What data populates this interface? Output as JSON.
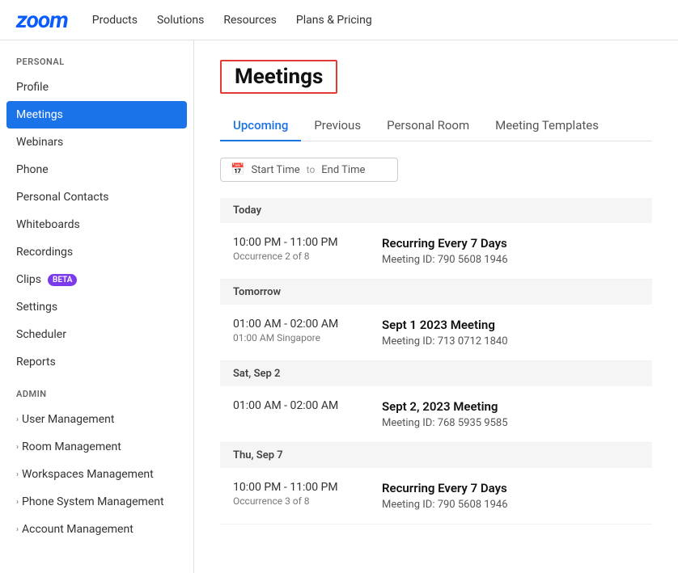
{
  "nav": {
    "logo": "zoom",
    "items": [
      "Products",
      "Solutions",
      "Resources",
      "Plans & Pricing"
    ]
  },
  "sidebar": {
    "personal_label": "PERSONAL",
    "admin_label": "ADMIN",
    "personal_items": [
      {
        "label": "Profile",
        "active": false
      },
      {
        "label": "Meetings",
        "active": true
      },
      {
        "label": "Webinars",
        "active": false
      },
      {
        "label": "Phone",
        "active": false
      },
      {
        "label": "Personal Contacts",
        "active": false
      },
      {
        "label": "Whiteboards",
        "active": false
      },
      {
        "label": "Recordings",
        "active": false
      },
      {
        "label": "Clips",
        "active": false,
        "badge": "BETA"
      },
      {
        "label": "Settings",
        "active": false
      },
      {
        "label": "Scheduler",
        "active": false
      },
      {
        "label": "Reports",
        "active": false
      }
    ],
    "admin_items": [
      {
        "label": "User Management"
      },
      {
        "label": "Room Management"
      },
      {
        "label": "Workspaces Management"
      },
      {
        "label": "Phone System Management"
      },
      {
        "label": "Account Management"
      }
    ]
  },
  "main": {
    "title": "Meetings",
    "tabs": [
      "Upcoming",
      "Previous",
      "Personal Room",
      "Meeting Templates"
    ],
    "active_tab": 0,
    "date_filter": {
      "start_placeholder": "Start Time",
      "separator": "to",
      "end_placeholder": "End Time"
    },
    "groups": [
      {
        "header": "Today",
        "meetings": [
          {
            "time": "10:00 PM - 11:00 PM",
            "sub": "Occurrence 2 of 8",
            "title": "Recurring Every 7 Days",
            "id": "Meeting ID: 790 5608 1946"
          }
        ]
      },
      {
        "header": "Tomorrow",
        "meetings": [
          {
            "time": "01:00 AM - 02:00 AM",
            "sub": "01:00 AM Singapore",
            "title": "Sept 1 2023 Meeting",
            "id": "Meeting ID: 713 0712 1840"
          }
        ]
      },
      {
        "header": "Sat, Sep 2",
        "meetings": [
          {
            "time": "01:00 AM - 02:00 AM",
            "sub": "",
            "title": "Sept 2, 2023 Meeting",
            "id": "Meeting ID: 768 5935 9585"
          }
        ]
      },
      {
        "header": "Thu, Sep 7",
        "meetings": [
          {
            "time": "10:00 PM - 11:00 PM",
            "sub": "Occurrence 3 of 8",
            "title": "Recurring Every 7 Days",
            "id": "Meeting ID: 790 5608 1946"
          }
        ]
      }
    ]
  }
}
